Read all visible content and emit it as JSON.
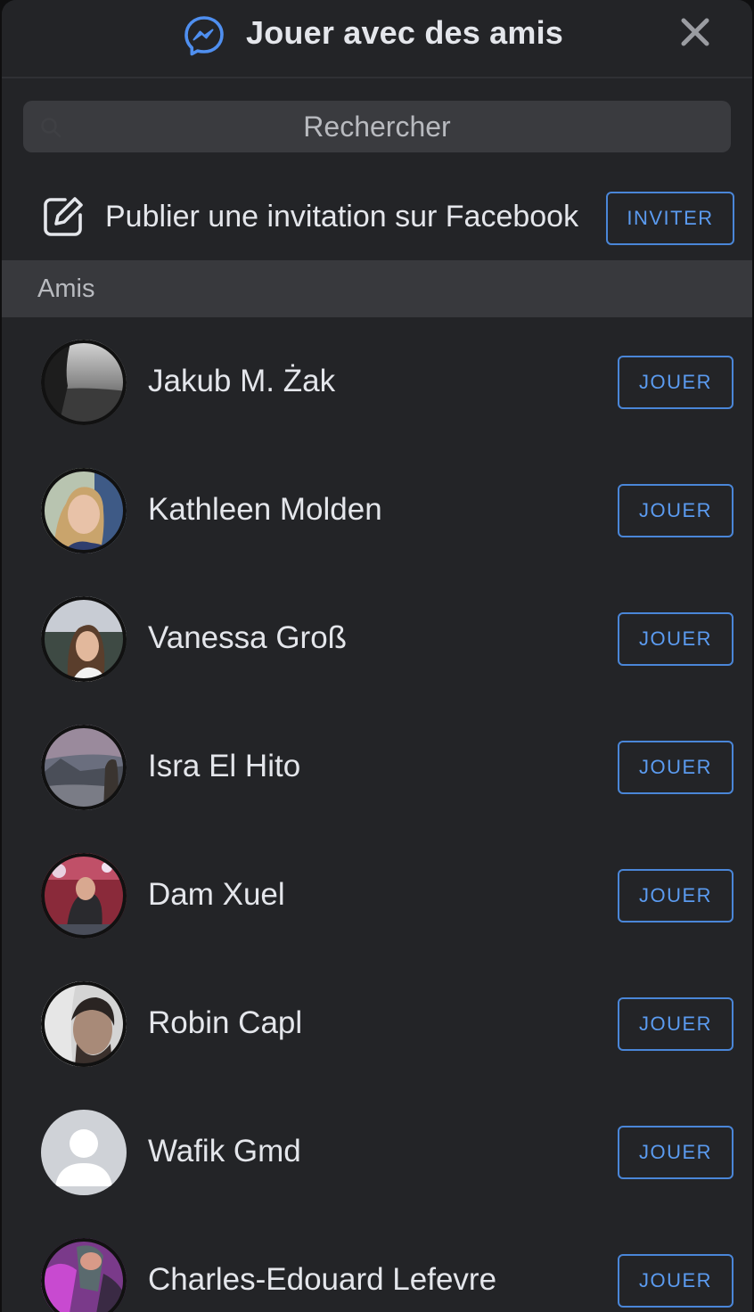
{
  "header": {
    "title": "Jouer avec des amis",
    "icon": "messenger-icon",
    "close_icon": "close-icon"
  },
  "search": {
    "placeholder": "Rechercher",
    "value": ""
  },
  "invite": {
    "label": "Publier une invitation sur Facebook",
    "button_label": "INVITER",
    "icon": "compose-icon"
  },
  "section": {
    "label": "Amis"
  },
  "friends": [
    {
      "name": "Jakub M. Żak",
      "button_label": "JOUER"
    },
    {
      "name": "Kathleen Molden",
      "button_label": "JOUER"
    },
    {
      "name": "Vanessa Groß",
      "button_label": "JOUER"
    },
    {
      "name": "Isra El Hito",
      "button_label": "JOUER"
    },
    {
      "name": "Dam Xuel",
      "button_label": "JOUER"
    },
    {
      "name": "Robin Capl",
      "button_label": "JOUER"
    },
    {
      "name": "Wafik Gmd",
      "button_label": "JOUER"
    },
    {
      "name": "Charles-Edouard Lefevre",
      "button_label": "JOUER"
    }
  ],
  "colors": {
    "background": "#232427",
    "accent": "#4a86d8",
    "section_background": "#38393d"
  }
}
